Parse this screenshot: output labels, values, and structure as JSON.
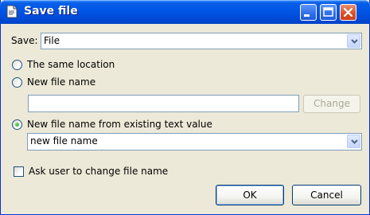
{
  "window": {
    "title": "Save file"
  },
  "save_field": {
    "label": "Save:",
    "value": "File"
  },
  "options": {
    "same_location": "The same location",
    "new_file_name": "New file name",
    "new_file_name_value": "",
    "change_button": "Change",
    "from_text_value": "New file name from existing text value",
    "text_value": "new file name",
    "selected": "from_text_value"
  },
  "ask_user": {
    "label": "Ask user to change file name",
    "checked": false
  },
  "buttons": {
    "ok": "OK",
    "cancel": "Cancel"
  },
  "colors": {
    "titlebar": "#0055e5",
    "dialog_bg": "#ece9d8",
    "radio_selected": "#21a121",
    "close_button": "#d9522b"
  }
}
